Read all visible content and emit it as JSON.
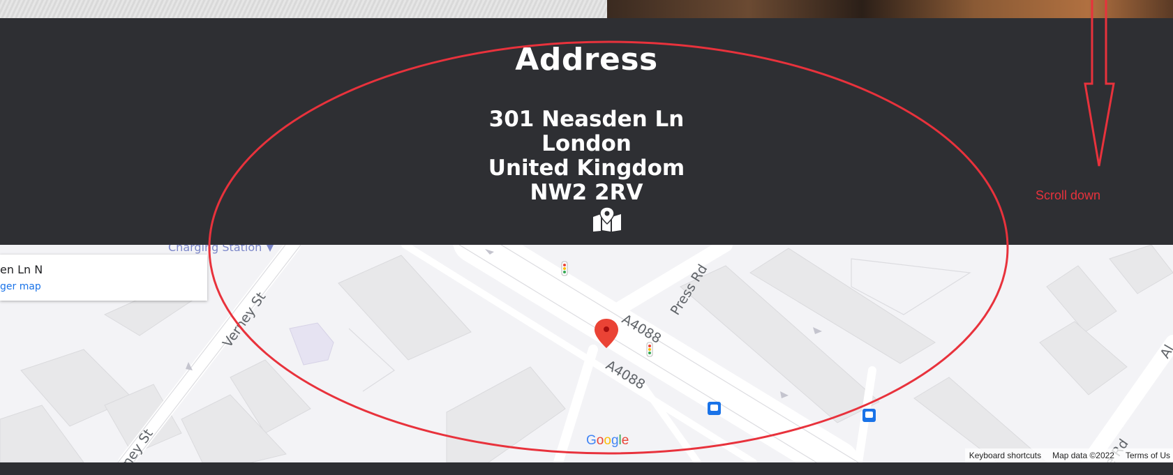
{
  "address": {
    "title": "Address",
    "lines": [
      "301 Neasden Ln",
      "London",
      "United Kingdom",
      "NW2 2RV"
    ],
    "icon": "map-location-icon"
  },
  "map": {
    "place_name": "en Ln N",
    "place_link": "ger map",
    "charging_label": "Charging Station",
    "road_labels": {
      "a4088_upper": "A4088",
      "a4088_lower": "A4088",
      "press_rd": "Press Rd",
      "verney_st": "Verney St",
      "verney_st_lower": "ney St",
      "other_rd": "e Rd",
      "edge_a": "Al"
    },
    "google": [
      "G",
      "o",
      "o",
      "g",
      "l",
      "e"
    ],
    "google_colors": [
      "#4285f4",
      "#ea4335",
      "#fbbc05",
      "#4285f4",
      "#34a853",
      "#ea4335"
    ],
    "footer": {
      "keyboard": "Keyboard shortcuts",
      "map_data": "Map data ©2022",
      "terms": "Terms of Us"
    }
  },
  "annotation": {
    "scroll_text": "Scroll down",
    "color": "#e8323c"
  }
}
